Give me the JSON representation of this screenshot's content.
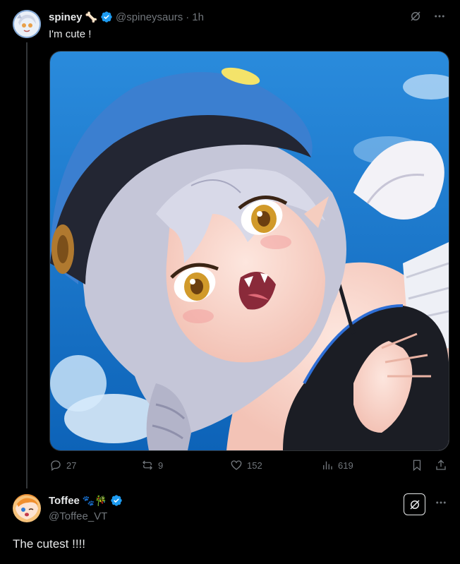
{
  "post": {
    "author_name": "spiney",
    "author_emoji": "🦴",
    "handle": "@spineysaurs",
    "separator": "·",
    "time": "1h",
    "text": "I'm cute !",
    "stats": {
      "replies": "27",
      "reposts": "9",
      "likes": "152",
      "views": "619"
    }
  },
  "reply": {
    "author_name": "Toffee",
    "author_emojis": "🐾🎋",
    "handle": "@Toffee_VT",
    "text": "The cutest !!!!"
  },
  "colors": {
    "background": "#000000",
    "text_primary": "#e7e9ea",
    "text_secondary": "#71767b",
    "verified_blue": "#1d9bf0",
    "thread_line": "#333639"
  },
  "icons": {
    "grok": "grok-icon",
    "more": "more-dots-icon",
    "reply": "reply-icon",
    "repost": "repost-icon",
    "like": "heart-icon",
    "views": "views-icon",
    "bookmark": "bookmark-icon",
    "share": "share-icon"
  }
}
